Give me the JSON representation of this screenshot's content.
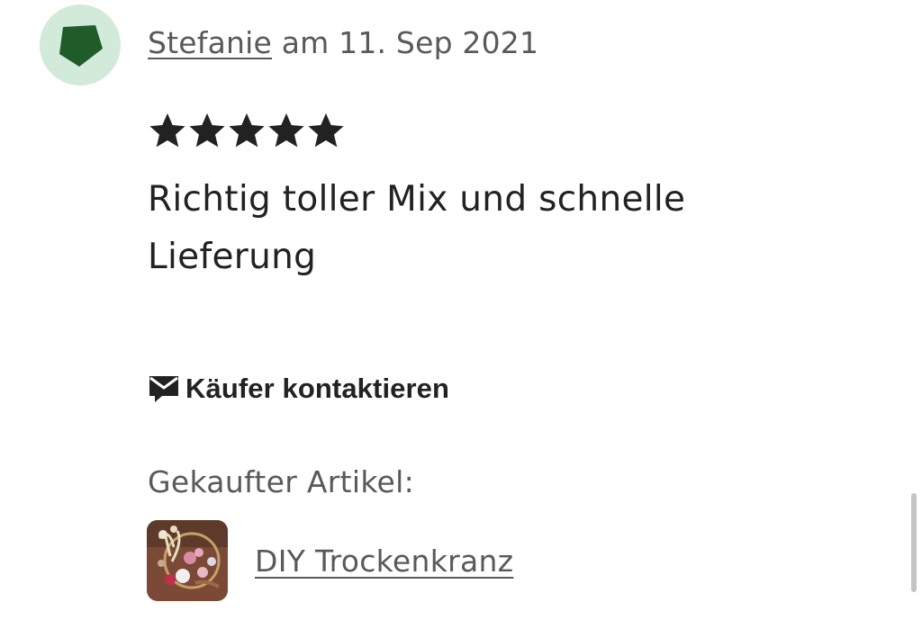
{
  "review": {
    "author": "Stefanie",
    "date_text": " am 11. Sep 2021",
    "rating": 5,
    "rating_max": 5,
    "text": "Richtig toller Mix und schnelle Lieferung",
    "contact_label": "Käufer kontaktieren",
    "purchased_label": "Gekaufter Artikel:",
    "item_title": "DIY Trockenkranz"
  },
  "icons": {
    "avatar": "green-pentagon-avatar-icon",
    "star": "star-icon",
    "contact": "message-envelope-icon"
  },
  "colors": {
    "avatar_bg": "#d2ead9",
    "avatar_shape": "#1f5c2a",
    "text": "#222222",
    "muted": "#595959"
  }
}
